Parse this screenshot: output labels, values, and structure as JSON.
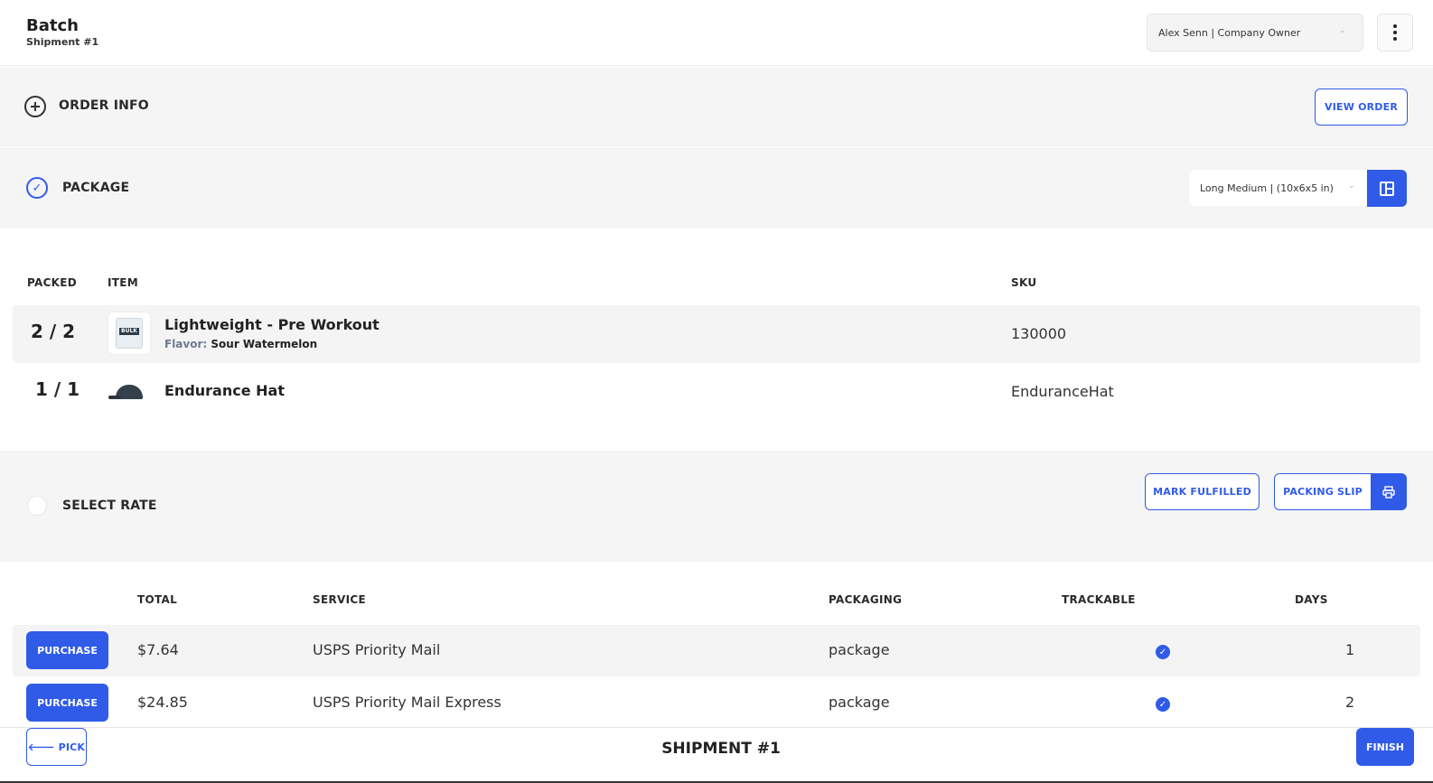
{
  "header": {
    "title": "Batch",
    "subtitle": "Shipment #1",
    "user_select": "Alex Senn | Company Owner"
  },
  "order_info": {
    "label": "ORDER INFO",
    "view_order_label": "VIEW ORDER"
  },
  "package": {
    "label": "PACKAGE",
    "selected_box": "Long Medium | (10x6x5 in)"
  },
  "items_table": {
    "headers": [
      "PACKED",
      "ITEM",
      "SKU"
    ],
    "rows": [
      {
        "packed": "2 / 2",
        "name": "Lightweight - Pre Workout",
        "option_key": "Flavor:",
        "option_value": "Sour Watermelon",
        "sku": "130000",
        "thumb_text": "BULK"
      },
      {
        "packed": "1 / 1",
        "name": "Endurance Hat",
        "sku": "EnduranceHat"
      }
    ]
  },
  "select_rate": {
    "label": "SELECT RATE",
    "mark_fulfilled_label": "MARK FULFILLED",
    "packing_slip_label": "PACKING SLIP"
  },
  "rates_table": {
    "headers": [
      "TOTAL",
      "SERVICE",
      "PACKAGING",
      "TRACKABLE",
      "DAYS"
    ],
    "rows": [
      {
        "action": "PURCHASE",
        "total": "$7.64",
        "service": "USPS Priority Mail",
        "packaging": "package",
        "trackable": true,
        "days": "1"
      },
      {
        "action": "PURCHASE",
        "total": "$24.85",
        "service": "USPS Priority Mail Express",
        "packaging": "package",
        "trackable": true,
        "days": "2"
      }
    ]
  },
  "footer": {
    "pick_label": "🡐 PICK",
    "title": "SHIPMENT #1",
    "finish_label": "FINISH"
  },
  "colors": {
    "accent": "#2f5be8",
    "section_bg": "#f5f5f5"
  }
}
